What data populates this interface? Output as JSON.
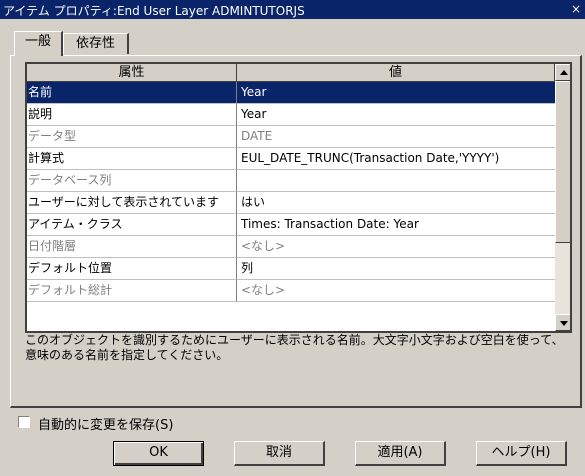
{
  "window": {
    "title": "アイテム プロパティ:End User Layer  ADMINTUTORJS",
    "close_glyph": "×"
  },
  "tabs": [
    {
      "label": "一般"
    },
    {
      "label": "依存性"
    }
  ],
  "grid": {
    "headers": {
      "property": "属性",
      "value": "値"
    },
    "rows": [
      {
        "property": "名前",
        "value": "Year"
      },
      {
        "property": "説明",
        "value": "Year"
      },
      {
        "property": "データ型",
        "value": "DATE"
      },
      {
        "property": "計算式",
        "value": "EUL_DATE_TRUNC(Transaction Date,'YYYY')"
      },
      {
        "property": "データベース列",
        "value": ""
      },
      {
        "property": "ユーザーに対して表示されています",
        "value": "はい"
      },
      {
        "property": "アイテム・クラス",
        "value": "Times: Transaction Date: Year"
      },
      {
        "property": "日付階層",
        "value": "<なし>"
      },
      {
        "property": "デフォルト位置",
        "value": "列"
      },
      {
        "property": "デフォルト総計",
        "value": "<なし>"
      }
    ]
  },
  "description": "このオブジェクトを識別するためにユーザーに表示される名前。大文字小文字および空白を使って、意味のある名前を指定してください。",
  "autosave": {
    "label": "自動的に変更を保存(S)",
    "checked": false
  },
  "buttons": {
    "ok": "OK",
    "cancel": "取消",
    "apply": "適用(A)",
    "help": "ヘルプ(H)"
  }
}
